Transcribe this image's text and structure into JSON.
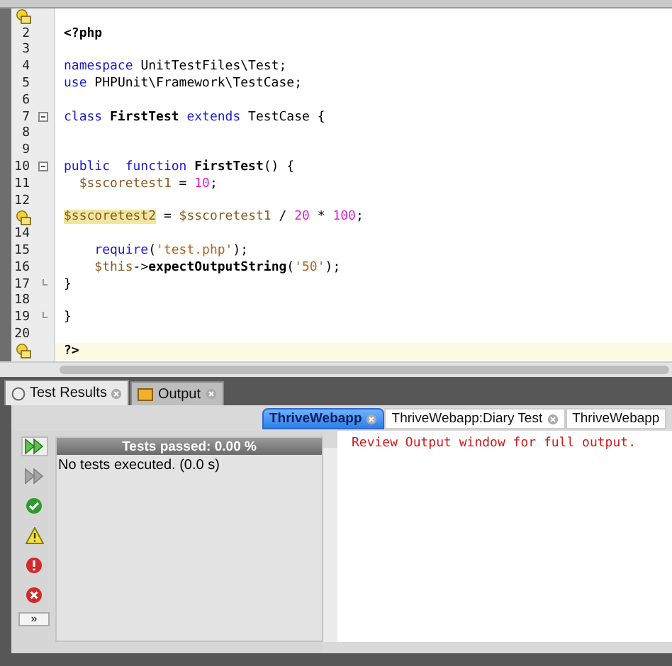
{
  "editor": {
    "lines": [
      {
        "hint": true
      },
      {
        "number": "2",
        "tokens": [
          {
            "kind": "name",
            "text": "<?php"
          }
        ]
      },
      {
        "number": "3"
      },
      {
        "number": "4",
        "tokens": [
          {
            "kind": "kw",
            "text": "namespace"
          },
          {
            "kind": "text",
            "text": " UnitTestFiles\\Test;"
          }
        ]
      },
      {
        "number": "5",
        "tokens": [
          {
            "kind": "kw",
            "text": "use"
          },
          {
            "kind": "text",
            "text": " PHPUnit\\Framework\\TestCase;"
          }
        ]
      },
      {
        "number": "6"
      },
      {
        "number": "7",
        "fold_open": true,
        "tokens": [
          {
            "kind": "kw",
            "text": "class"
          },
          {
            "kind": "name",
            "text": " FirstTest "
          },
          {
            "kind": "kw",
            "text": "extends"
          },
          {
            "kind": "text",
            "text": " TestCase {"
          }
        ]
      },
      {
        "number": "8"
      },
      {
        "number": "9"
      },
      {
        "number": "10",
        "fold_open": true,
        "tokens": [
          {
            "kind": "kw",
            "text": "public  function"
          },
          {
            "kind": "name",
            "text": " FirstTest"
          },
          {
            "kind": "text",
            "text": "() {"
          }
        ]
      },
      {
        "number": "11",
        "tokens": [
          {
            "kind": "var",
            "text": "  $sscoretest1"
          },
          {
            "kind": "text",
            "text": " = "
          },
          {
            "kind": "num",
            "text": "10"
          },
          {
            "kind": "text",
            "text": ";"
          }
        ]
      },
      {
        "number": "12"
      },
      {
        "hint": true,
        "tokens": [
          {
            "kind": "mark",
            "text": "$sscoretest2"
          },
          {
            "kind": "text",
            "text": " = "
          },
          {
            "kind": "var",
            "text": "$sscoretest1"
          },
          {
            "kind": "text",
            "text": " / "
          },
          {
            "kind": "num",
            "text": "20"
          },
          {
            "kind": "text",
            "text": " * "
          },
          {
            "kind": "num",
            "text": "100"
          },
          {
            "kind": "text",
            "text": ";"
          }
        ]
      },
      {
        "number": "14"
      },
      {
        "number": "15",
        "tokens": [
          {
            "kind": "kw",
            "text": "    require"
          },
          {
            "kind": "text",
            "text": "("
          },
          {
            "kind": "str",
            "text": "'test.php'"
          },
          {
            "kind": "text",
            "text": ");"
          }
        ]
      },
      {
        "number": "16",
        "tokens": [
          {
            "kind": "var",
            "text": "    $this"
          },
          {
            "kind": "text",
            "text": "->"
          },
          {
            "kind": "name",
            "text": "expectOutputString"
          },
          {
            "kind": "text",
            "text": "("
          },
          {
            "kind": "str",
            "text": "'50'"
          },
          {
            "kind": "text",
            "text": ");"
          }
        ]
      },
      {
        "number": "17",
        "fold_close": true,
        "tokens": [
          {
            "kind": "text",
            "text": "}"
          }
        ]
      },
      {
        "number": "18"
      },
      {
        "number": "19",
        "fold_close": true,
        "tokens": [
          {
            "kind": "text",
            "text": "}"
          }
        ]
      },
      {
        "number": "20"
      },
      {
        "hint": true,
        "current": true,
        "tokens": [
          {
            "kind": "name",
            "text": "?>"
          }
        ]
      }
    ]
  },
  "panel_tabs": [
    {
      "label": "Test Results",
      "selected": true
    },
    {
      "label": "Output",
      "selected": false
    }
  ],
  "session_tabs": [
    {
      "label": "ThriveWebapp",
      "selected": true,
      "closable": true
    },
    {
      "label": "ThriveWebapp:Diary Test",
      "selected": false,
      "closable": true
    },
    {
      "label": "ThriveWebapp",
      "selected": false,
      "closable": false
    }
  ],
  "toolbar": [
    {
      "kind": "rerun",
      "disabled": false
    },
    {
      "kind": "rerun-failed",
      "disabled": true
    },
    {
      "kind": "passed"
    },
    {
      "kind": "warning"
    },
    {
      "kind": "error"
    },
    {
      "kind": "failure"
    }
  ],
  "more_button": "»",
  "progress": {
    "label": "Tests passed: 0.00 %",
    "level": 0
  },
  "summary": "No tests executed. (0.0 s)",
  "output": "Review Output window for full output."
}
